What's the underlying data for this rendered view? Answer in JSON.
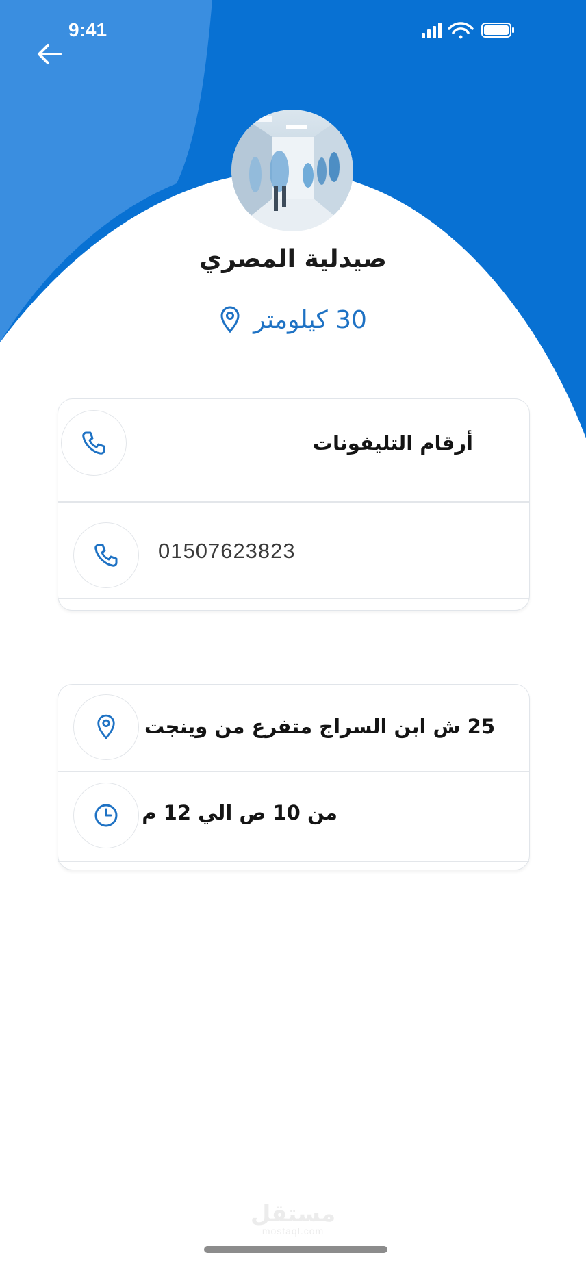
{
  "status_bar": {
    "time": "9:41"
  },
  "pharmacy": {
    "name": "صيدلية المصري",
    "distance": "30 كيلومتر"
  },
  "phones_card": {
    "header": "أرقام التليفونات",
    "numbers": [
      "01507623823"
    ]
  },
  "info_card": {
    "address": "25 ش ابن السراج متفرع من وينجت",
    "hours": "من 10 ص الي 12 م"
  },
  "watermark": {
    "main": "مستقل",
    "sub": "mostaql.com"
  },
  "colors": {
    "primary_blue": "#0871d3",
    "light_blue": "#3a8ee0",
    "accent_text": "#1e72c4"
  },
  "icons": [
    "back-arrow-icon",
    "signal-icon",
    "wifi-icon",
    "battery-icon",
    "location-pin-icon",
    "phone-icon",
    "clock-icon"
  ]
}
